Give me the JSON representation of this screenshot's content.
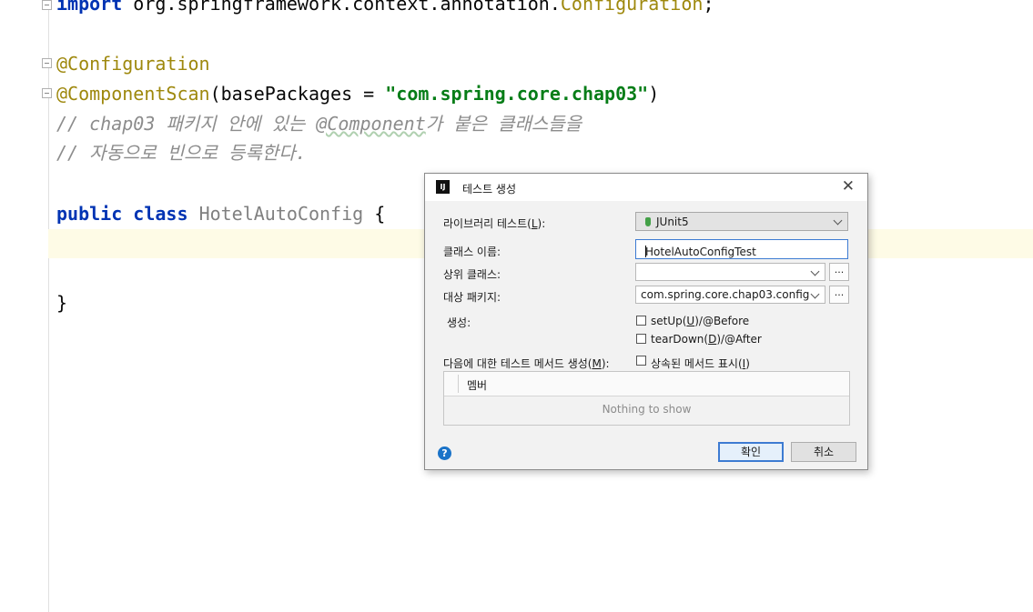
{
  "editor": {
    "lines": {
      "import_kw": "import",
      "import_path": " org.springframework.context.annotation.",
      "import_cls": "Configuration",
      "import_semi": ";",
      "ann_config": "@Configuration",
      "ann_scan": "@ComponentScan",
      "scan_open": "(basePackages = ",
      "scan_value": "\"com.spring.core.chap03\"",
      "scan_close": ")",
      "comment1_a": "// chap03 패키지 안에 있는 ",
      "comment1_b": "@Component",
      "comment1_c": "가 붙은 클래스들을",
      "comment2": "// 자동으로 빈으로 등록한다.",
      "public_kw": "public",
      "class_kw": "class",
      "class_name": "HotelAutoConfig",
      "brace_open": " {",
      "brace_close": "}"
    },
    "colors": {
      "keyword": "#0033b3",
      "annotation": "#9e880d",
      "string": "#067d17",
      "comment": "#8c8c8c",
      "caret_line": "#fefbe6"
    }
  },
  "dialog": {
    "title": "테스트 생성",
    "close_icon": "close-icon",
    "library_label_pre": "라이브러리 테스트(",
    "library_label_key": "L",
    "library_label_post": "):",
    "library_value": "JUnit5",
    "class_name_label": "클래스 이름:",
    "class_name_value": "HotelAutoConfigTest",
    "superclass_label": "상위 클래스:",
    "superclass_value": "",
    "package_label": "대상 패키지:",
    "package_value": "com.spring.core.chap03.config",
    "browse_label": "...",
    "generate_label": "생성:",
    "setup_pre": "setUp(",
    "setup_key": "U",
    "setup_post": ")/@Before",
    "teardown_pre": "tearDown(",
    "teardown_key": "D",
    "teardown_post": ")/@After",
    "methods_label_pre": "다음에 대한 테스트 메서드 생성(",
    "methods_label_key": "M",
    "methods_label_post": "):",
    "inherited_pre": "상속된 메서드 표시(",
    "inherited_key": "I",
    "inherited_post": ")",
    "table_header": "멤버",
    "table_empty": "Nothing to show",
    "help_label": "?",
    "ok_label": "확인",
    "cancel_label": "취소"
  }
}
